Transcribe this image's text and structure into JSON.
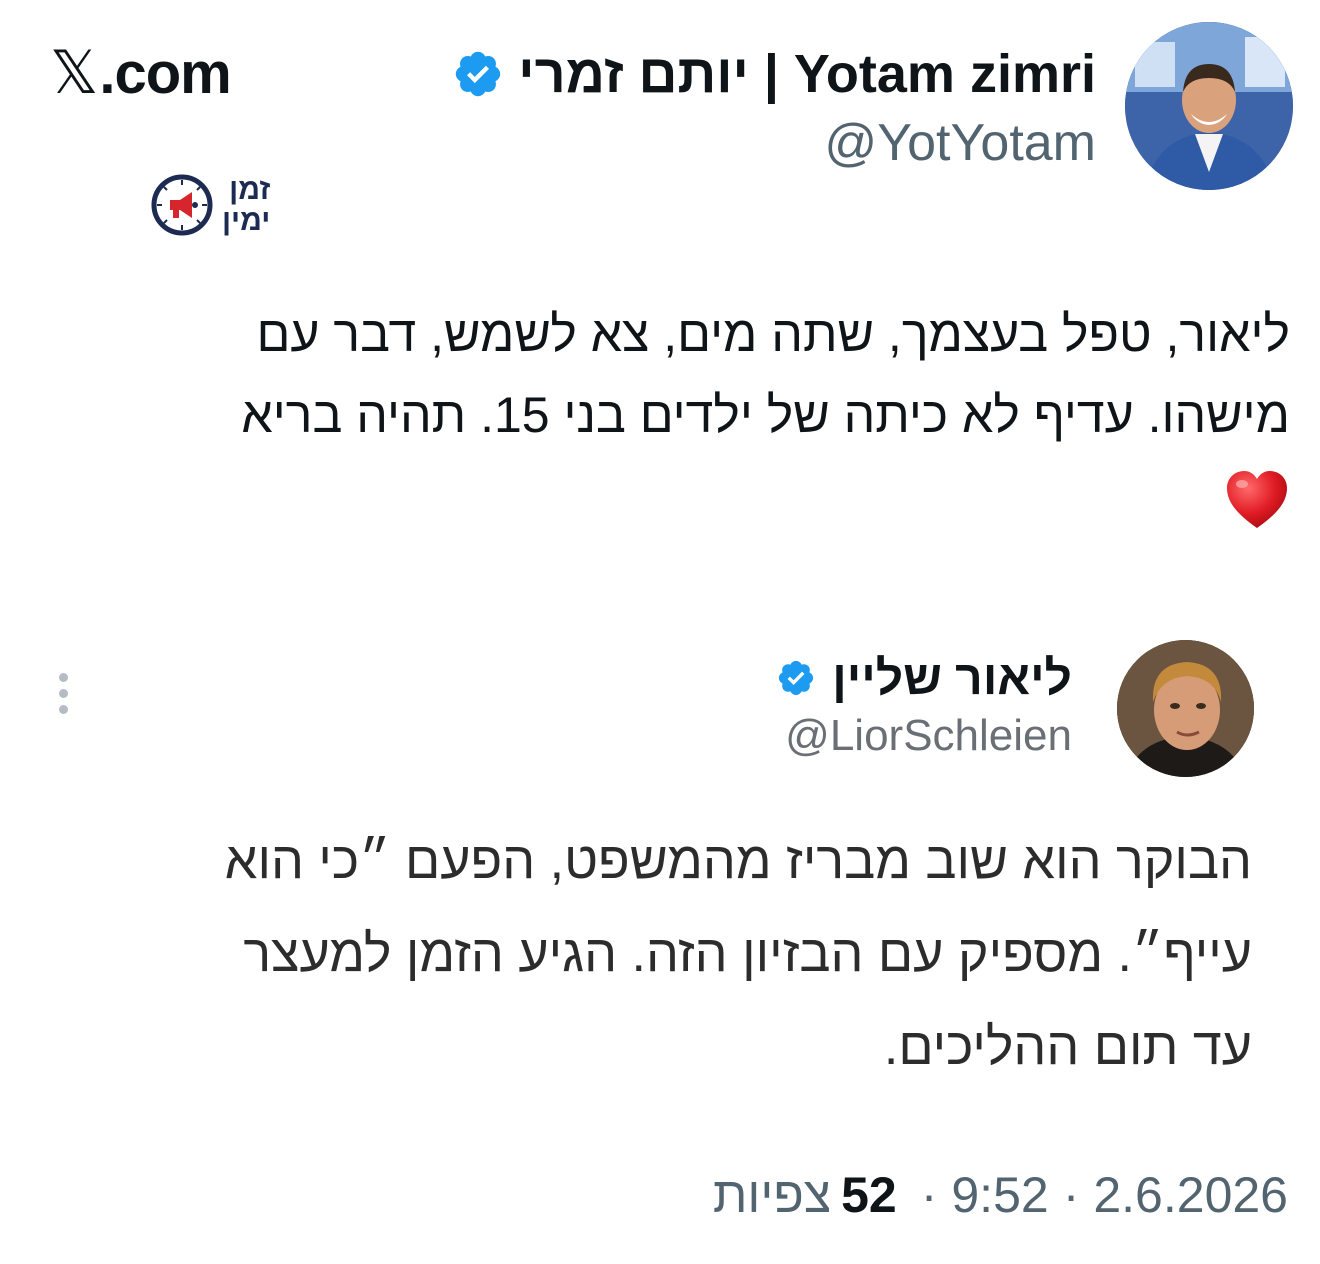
{
  "brand": {
    "site": ".com",
    "x_glyph": "𝕏"
  },
  "author": {
    "name": "יותם זמרי | Yotam zimri",
    "handle": "@YotYotam",
    "verified_color": "#1d9bf0"
  },
  "channel_logo": {
    "line1": "זמן",
    "line2": "ימין",
    "icon": "megaphone-clock-icon"
  },
  "post": {
    "lines": [
      "ליאור, טפל בעצמך, שתה מים, צא לשמש, דבר עם",
      "מישהו. עדיף לא כיתה של ילדים בני 15. תהיה בריא"
    ],
    "emoji": "heart-icon"
  },
  "quoted": {
    "name": "ליאור שליין",
    "handle": "@LiorSchleien",
    "lines": [
      "הבוקר הוא שוב מבריז מהמשפט, הפעם ״כי הוא",
      "עייף״. מספיק עם הבזיון הזה. הגיע הזמן למעצר",
      "עד תום ההליכים."
    ]
  },
  "meta": {
    "date": "2.6.2026",
    "time": "9:52",
    "separator": "·",
    "views_count": "52",
    "views_label": "צפיות"
  }
}
